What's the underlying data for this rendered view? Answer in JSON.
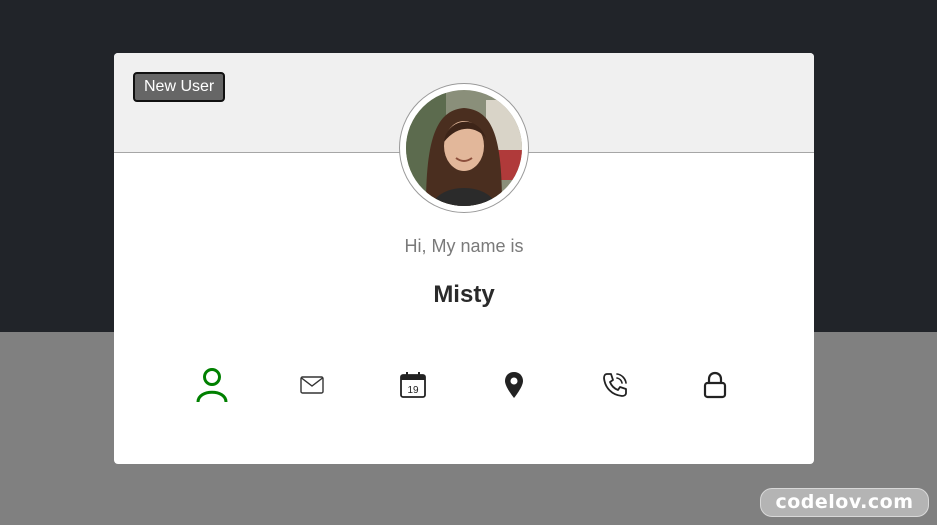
{
  "badge": {
    "label": "New User"
  },
  "profile": {
    "greeting": "Hi, My name is",
    "name": "Misty"
  },
  "toolbar": {
    "icons": [
      {
        "name": "user-icon",
        "active": true
      },
      {
        "name": "mail-icon",
        "active": false
      },
      {
        "name": "calendar-icon",
        "active": false,
        "day": "19"
      },
      {
        "name": "location-pin-icon",
        "active": false
      },
      {
        "name": "phone-icon",
        "active": false
      },
      {
        "name": "lock-icon",
        "active": false
      }
    ]
  },
  "watermark": {
    "text": "codelov.com"
  },
  "colors": {
    "active": "#008000",
    "inactive": "#333333",
    "top_background": "#212429",
    "bottom_background": "#808080"
  }
}
